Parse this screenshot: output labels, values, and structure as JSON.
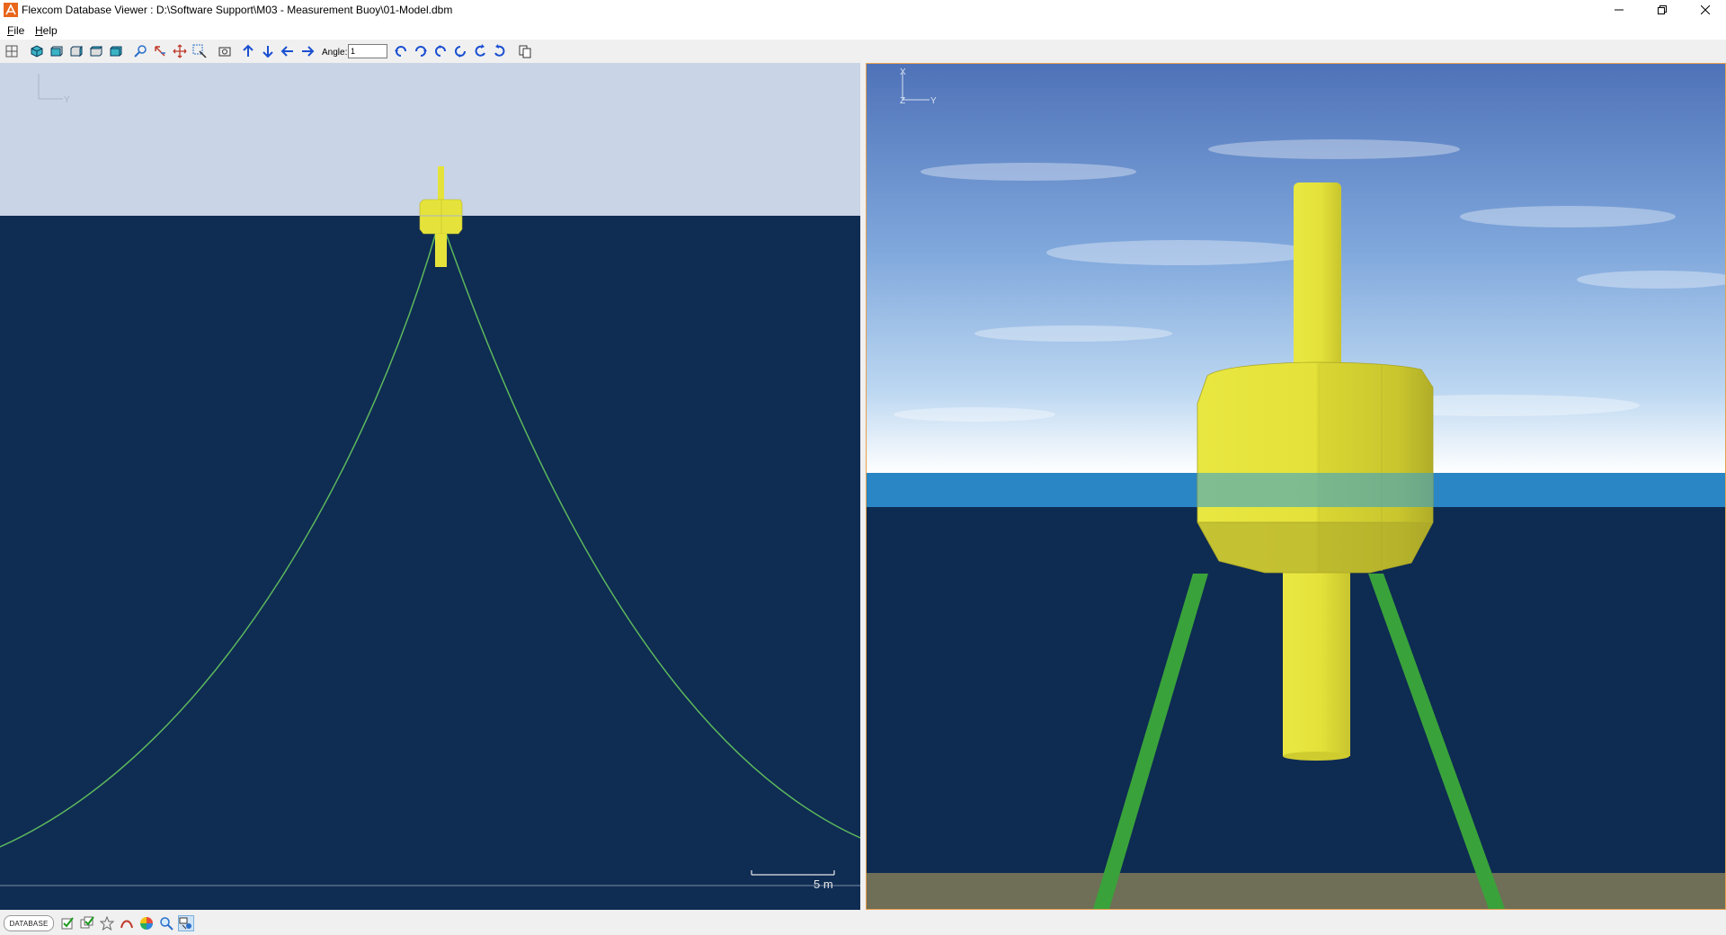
{
  "window": {
    "title": "Flexcom Database Viewer : D:\\Software Support\\M03 - Measurement Buoy\\01-Model.dbm",
    "controls": [
      "minimize",
      "restore",
      "close"
    ]
  },
  "menu": {
    "items": [
      {
        "accel": "F",
        "rest": "ile"
      },
      {
        "accel": "H",
        "rest": "elp"
      }
    ]
  },
  "toolbar": {
    "angle_label": "Angle:",
    "angle_value": "1",
    "icons": [
      "grid-icon",
      "view-iso-icon",
      "view-front-icon",
      "view-side-icon",
      "view-top-icon",
      "view-back-icon",
      "zoom-in-icon",
      "zoom-out-icon",
      "pan-icon",
      "zoom-box-icon",
      "camera-icon",
      "arrow-up-icon",
      "arrow-down-icon",
      "arrow-left-icon",
      "arrow-right-icon",
      "rotate-left-icon",
      "rotate-right-icon",
      "rotate-up-icon",
      "rotate-down-icon",
      "spin-cw-icon",
      "spin-ccw-icon",
      "copy-icon"
    ]
  },
  "left_view": {
    "axis_labels": {
      "vertical": "",
      "horizontal": "Y"
    },
    "scale_bar_label": "5 m",
    "colors": {
      "sky": "#c9d4e6",
      "sea": "#0f2c53",
      "mooring": "#5cb85c",
      "buoy": "#e5e33b"
    }
  },
  "right_view": {
    "axis_labels": {
      "vertical": "X",
      "origin": "Z",
      "horizontal": "Y"
    },
    "colors": {
      "sea_surface": "#2a86c4",
      "deep_water": "#0e2b52",
      "seabed": "#6f6e57",
      "mooring": "#3aa23a",
      "buoy": "#e2e13a"
    }
  },
  "statusbar": {
    "database_label": "DATABASE",
    "icons": [
      "check-icon",
      "check-multi-icon",
      "star-icon",
      "curve-icon",
      "color-wheel-icon",
      "search-icon",
      "settings-view-icon"
    ]
  }
}
